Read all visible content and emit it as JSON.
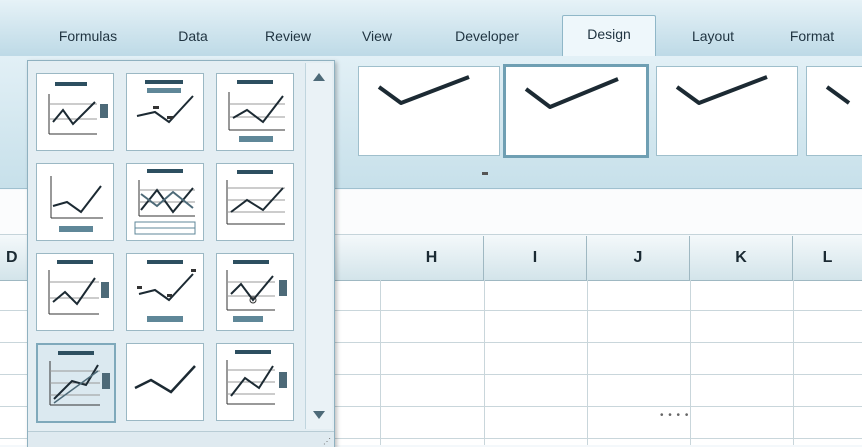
{
  "ribbon": {
    "tabs": [
      {
        "label": "Formulas"
      },
      {
        "label": "Data"
      },
      {
        "label": "Review"
      },
      {
        "label": "View"
      },
      {
        "label": "Developer"
      },
      {
        "label": "Design",
        "active": true
      },
      {
        "label": "Layout"
      },
      {
        "label": "Format"
      }
    ]
  },
  "chart_layouts": {
    "count_visible": 12,
    "selected_index": 9,
    "items": [
      "layout-1",
      "layout-2",
      "layout-3",
      "layout-4",
      "layout-5",
      "layout-6",
      "layout-7",
      "layout-8",
      "layout-9",
      "layout-10",
      "layout-11",
      "layout-12"
    ]
  },
  "chart_styles": {
    "count_visible": 4,
    "selected_index": 1,
    "line_color": "#1c2a33"
  },
  "sheet": {
    "column_headers": [
      "D",
      "H",
      "I",
      "J",
      "K",
      "L"
    ]
  },
  "colors": {
    "ribbon": "#c7e0ea",
    "accent": "#6f9fb3"
  },
  "icons": {
    "scroll_up": "triangle-up-icon",
    "scroll_down": "triangle-down-icon",
    "resize_grip": "resize-grip-icon",
    "dialog_launcher": "dialog-launcher-icon"
  }
}
